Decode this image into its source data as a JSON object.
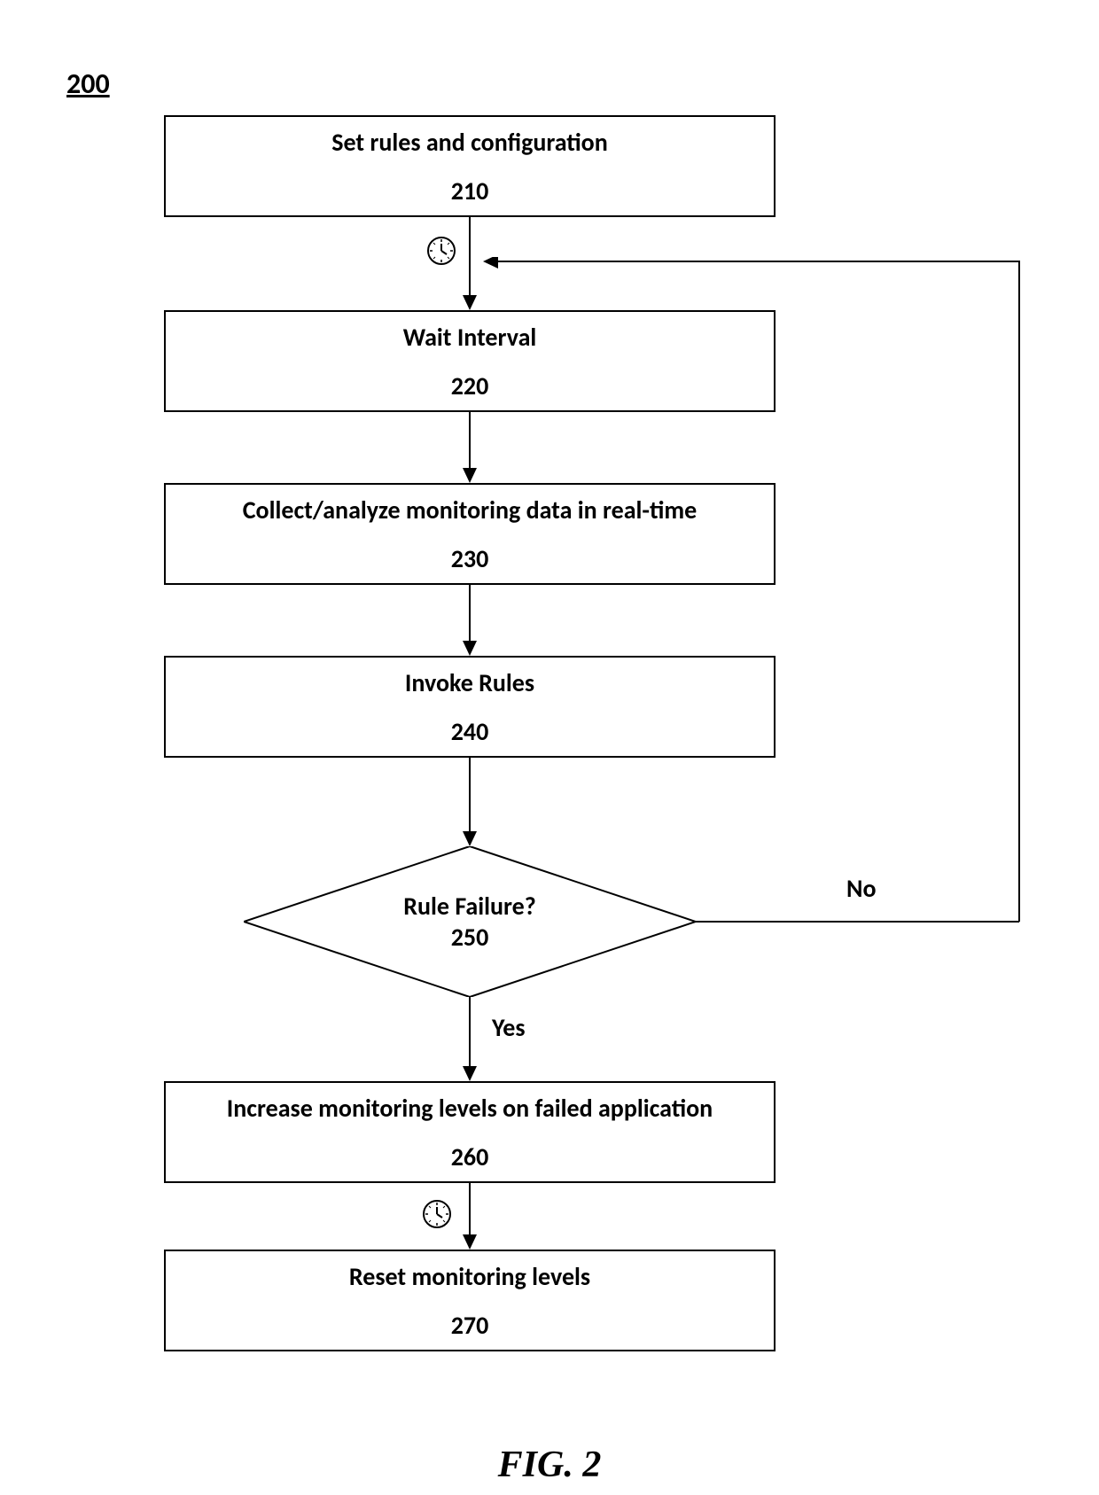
{
  "page_number": "200",
  "figure_label": "FIG. 2",
  "boxes": {
    "b210": {
      "title": "Set rules and configuration",
      "num": "210"
    },
    "b220": {
      "title": "Wait Interval",
      "num": "220"
    },
    "b230": {
      "title": "Collect/analyze monitoring data in real-time",
      "num": "230"
    },
    "b240": {
      "title": "Invoke Rules",
      "num": "240"
    },
    "b260": {
      "title": "Increase monitoring levels on failed application",
      "num": "260"
    },
    "b270": {
      "title": "Reset monitoring levels",
      "num": "270"
    }
  },
  "decision": {
    "title": "Rule Failure?",
    "num": "250"
  },
  "labels": {
    "yes": "Yes",
    "no": "No"
  }
}
